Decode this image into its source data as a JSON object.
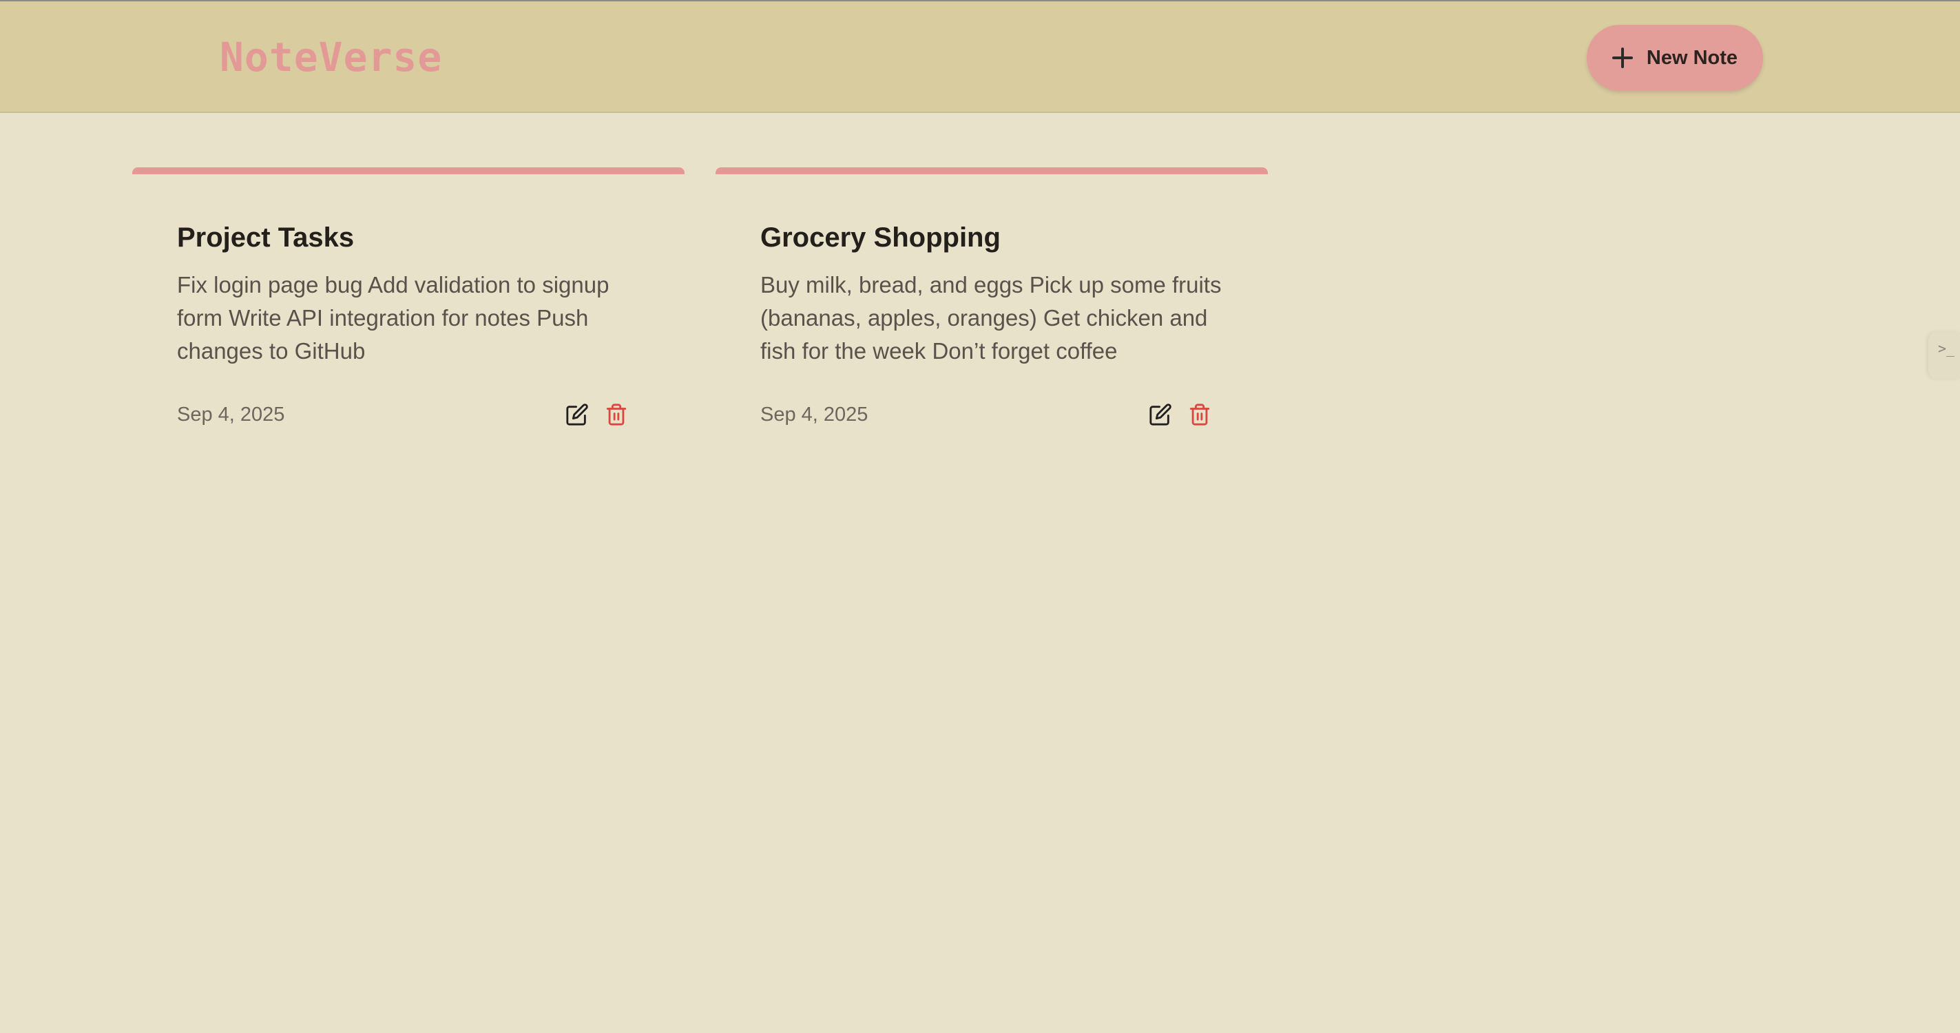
{
  "app": {
    "brand": "NoteVerse",
    "new_note_label": "New Note"
  },
  "colors": {
    "header_bg": "#d9cc9f",
    "page_bg": "#e8e2cb",
    "accent": "#e39a96",
    "delete_red": "#d9473f"
  },
  "icons": {
    "new_note": "plus-icon",
    "edit": "edit-icon",
    "delete": "trash-icon",
    "side_handle": "terminal-icon"
  },
  "notes": [
    {
      "title": "Project Tasks",
      "body": "Fix login page bug Add validation to signup form Write API integration for notes Push changes to GitHub",
      "date": "Sep 4, 2025"
    },
    {
      "title": "Grocery Shopping",
      "body": "Buy milk, bread, and eggs Pick up some fruits (bananas, apples, oranges) Get chicken and fish for the week Don’t forget coffee",
      "date": "Sep 4, 2025"
    }
  ]
}
